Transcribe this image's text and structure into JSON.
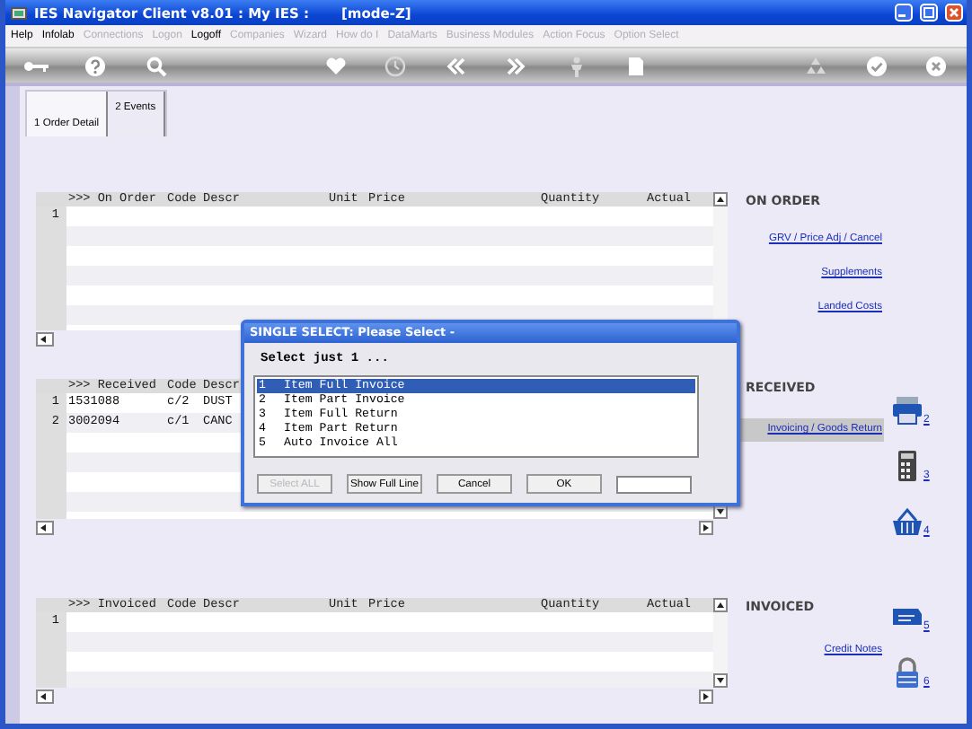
{
  "window": {
    "title": "IES Navigator Client v8.01 : My IES :",
    "mode": "[mode-Z]"
  },
  "menu": [
    {
      "label": "Help",
      "disabled": false
    },
    {
      "label": "Infolab",
      "disabled": false
    },
    {
      "label": "Connections",
      "disabled": true
    },
    {
      "label": "Logon",
      "disabled": true
    },
    {
      "label": "Logoff",
      "disabled": false
    },
    {
      "label": "Companies",
      "disabled": true
    },
    {
      "label": "Wizard",
      "disabled": true
    },
    {
      "label": "How do I",
      "disabled": true
    },
    {
      "label": "DataMarts",
      "disabled": true
    },
    {
      "label": "Business Modules",
      "disabled": true
    },
    {
      "label": "Action Focus",
      "disabled": true
    },
    {
      "label": "Option Select",
      "disabled": true
    }
  ],
  "tabs": [
    {
      "label": "1 Order Detail",
      "selected": true
    },
    {
      "label": "2 Events",
      "selected": false
    }
  ],
  "sections": [
    {
      "columns": [
        ">>> On Order",
        "Code",
        "Descr",
        "Unit",
        "Price",
        "Quantity",
        "Actual"
      ],
      "rows": [
        {
          "number": "1"
        }
      ],
      "side": {
        "heading": "ON ORDER",
        "links": [
          {
            "label": "GRV / Price Adj / Cancel",
            "selected": false
          },
          {
            "label": "Supplements",
            "selected": false
          },
          {
            "label": "Landed Costs",
            "selected": false
          }
        ]
      }
    },
    {
      "columns": [
        ">>> Received",
        "Code",
        "Descr"
      ],
      "rows": [
        {
          "number": "1",
          "cells": [
            "1531088",
            "c/2",
            "DUST"
          ]
        },
        {
          "number": "2",
          "cells": [
            "3002094",
            "c/1",
            "CANC"
          ]
        }
      ],
      "side": {
        "heading": "RECEIVED",
        "links": [
          {
            "label": "Invoicing / Goods Return",
            "selected": true
          }
        ]
      },
      "shortcuts": [
        {
          "number": "2"
        },
        {
          "number": "3"
        },
        {
          "number": "4"
        }
      ]
    },
    {
      "columns": [
        ">>> Invoiced",
        "Code",
        "Descr",
        "Unit",
        "Price",
        "Quantity",
        "Actual"
      ],
      "rows": [
        {
          "number": "1"
        }
      ],
      "side": {
        "heading": "INVOICED",
        "links": [
          {
            "label": "Credit Notes",
            "selected": false
          }
        ]
      },
      "shortcuts": [
        {
          "number": "5"
        },
        {
          "number": "6"
        }
      ]
    }
  ],
  "dialog": {
    "title": "SINGLE SELECT: Please Select -",
    "prompt": "Select just 1 ...",
    "items": [
      {
        "number": "1",
        "label": "Item Full Invoice",
        "selected": true
      },
      {
        "number": "2",
        "label": "Item Part Invoice",
        "selected": false
      },
      {
        "number": "3",
        "label": "Item Full Return",
        "selected": false
      },
      {
        "number": "4",
        "label": "Item Part Return",
        "selected": false
      },
      {
        "number": "5",
        "label": "Auto Invoice All",
        "selected": false
      }
    ],
    "buttons": [
      {
        "label": "Select ALL",
        "disabled": true
      },
      {
        "label": "Show Full Line",
        "disabled": false
      },
      {
        "label": "Cancel",
        "disabled": false
      },
      {
        "label": "OK",
        "disabled": false
      }
    ]
  }
}
